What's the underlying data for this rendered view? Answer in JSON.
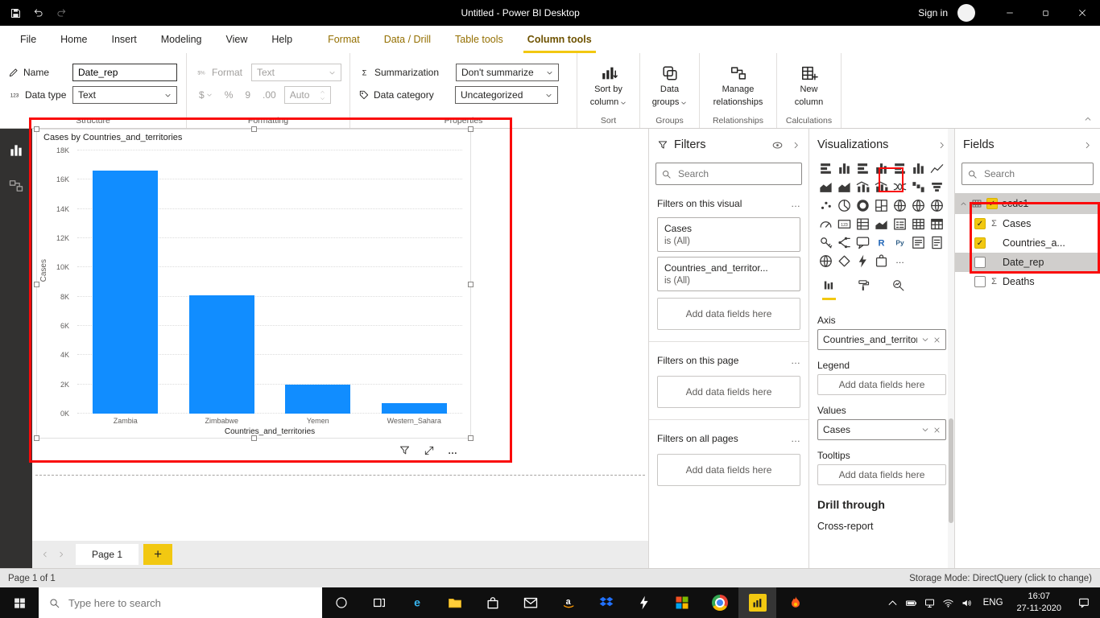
{
  "window": {
    "title": "Untitled - Power BI Desktop",
    "sign_in_label": "Sign in"
  },
  "ribbon": {
    "tabs": [
      {
        "label": "File",
        "kind": "normal"
      },
      {
        "label": "Home",
        "kind": "normal"
      },
      {
        "label": "Insert",
        "kind": "normal"
      },
      {
        "label": "Modeling",
        "kind": "normal"
      },
      {
        "label": "View",
        "kind": "normal"
      },
      {
        "label": "Help",
        "kind": "normal"
      },
      {
        "label": "Format",
        "kind": "contextual"
      },
      {
        "label": "Data / Drill",
        "kind": "contextual"
      },
      {
        "label": "Table tools",
        "kind": "contextual"
      },
      {
        "label": "Column tools",
        "kind": "contextual",
        "active": true
      }
    ],
    "structure": {
      "label": "Structure",
      "name_label": "Name",
      "name_value": "Date_rep",
      "datatype_label": "Data type",
      "datatype_value": "Text"
    },
    "formatting": {
      "label": "Formatting",
      "format_label": "Format",
      "format_value": "Text",
      "currency": "$",
      "percent": "%",
      "thousands": "9",
      "decimal": ".00",
      "auto_value": "Auto"
    },
    "properties": {
      "label": "Properties",
      "summarization_label": "Summarization",
      "summarization_value": "Don't summarize",
      "category_label": "Data category",
      "category_value": "Uncategorized"
    },
    "sort": {
      "label": "Sort",
      "line1": "Sort by",
      "line2": "column"
    },
    "data_groups": {
      "label": "Groups",
      "line1": "Data",
      "line2": "groups"
    },
    "relationships": {
      "label": "Relationships",
      "line1": "Manage",
      "line2": "relationships"
    },
    "calculations": {
      "label": "Calculations",
      "line1": "New",
      "line2": "column"
    }
  },
  "chart_data": {
    "type": "bar",
    "title": "Cases by Countries_and_territories",
    "categories": [
      "Zambia",
      "Zimbabwe",
      "Yemen",
      "Western_Sahara"
    ],
    "values": [
      16600,
      8100,
      2000,
      700
    ],
    "xlabel": "Countries_and_territories",
    "ylabel": "Cases",
    "ylim": [
      0,
      18000
    ],
    "yticks": [
      "0K",
      "2K",
      "4K",
      "6K",
      "8K",
      "10K",
      "12K",
      "14K",
      "16K",
      "18K"
    ],
    "bar_color": "#118DFF",
    "grid": true,
    "legend": false
  },
  "page": {
    "tab_label": "Page 1"
  },
  "statusbar": {
    "left": "Page 1 of 1",
    "right": "Storage Mode: DirectQuery (click to change)"
  },
  "filters": {
    "header": "Filters",
    "search_placeholder": "Search",
    "add_fields_label": "Add data fields here",
    "sections": [
      {
        "label": "Filters on this visual",
        "cards": [
          {
            "title": "Cases",
            "condition": "is (All)"
          },
          {
            "title": "Countries_and_territor...",
            "condition": "is (All)"
          }
        ],
        "show_empty_well": true
      },
      {
        "label": "Filters on this page",
        "cards": [],
        "show_empty_well": true
      },
      {
        "label": "Filters on all pages",
        "cards": [],
        "show_empty_well": true
      }
    ]
  },
  "visualizations": {
    "header": "Visualizations",
    "add_fields_label": "Add data fields here",
    "icons": [
      {
        "name": "stacked-bar-chart",
        "glyph": "barh"
      },
      {
        "name": "stacked-column-chart",
        "glyph": "colv"
      },
      {
        "name": "clustered-bar-chart",
        "glyph": "barh"
      },
      {
        "name": "clustered-column-chart",
        "glyph": "colv",
        "highlighted": true
      },
      {
        "name": "100-stacked-bar-chart",
        "glyph": "barh"
      },
      {
        "name": "100-stacked-column-chart",
        "glyph": "colv"
      },
      {
        "name": "line-chart",
        "glyph": "line"
      },
      {
        "name": "area-chart",
        "glyph": "area"
      },
      {
        "name": "stacked-area-chart",
        "glyph": "area"
      },
      {
        "name": "line-and-stacked-column-chart",
        "glyph": "combo"
      },
      {
        "name": "line-and-clustered-column-chart",
        "glyph": "combo"
      },
      {
        "name": "ribbon-chart",
        "glyph": "ribbonc"
      },
      {
        "name": "waterfall-chart",
        "glyph": "waterfall"
      },
      {
        "name": "funnel-chart",
        "glyph": "funnelc"
      },
      {
        "name": "scatter-chart",
        "glyph": "scatter"
      },
      {
        "name": "pie-chart",
        "glyph": "pie"
      },
      {
        "name": "donut-chart",
        "glyph": "donut"
      },
      {
        "name": "treemap",
        "glyph": "treemap"
      },
      {
        "name": "map",
        "glyph": "globe"
      },
      {
        "name": "filled-map",
        "glyph": "globe"
      },
      {
        "name": "shape-map",
        "glyph": "globe"
      },
      {
        "name": "gauge",
        "glyph": "gauge"
      },
      {
        "name": "card",
        "glyph": "card123"
      },
      {
        "name": "multi-row-card",
        "glyph": "mcard"
      },
      {
        "name": "kpi",
        "glyph": "kpi"
      },
      {
        "name": "slicer",
        "glyph": "slicer"
      },
      {
        "name": "table",
        "glyph": "tableic"
      },
      {
        "name": "matrix",
        "glyph": "matrix"
      },
      {
        "name": "key-influencers",
        "glyph": "keyinf"
      },
      {
        "name": "decomposition-tree",
        "glyph": "dtree"
      },
      {
        "name": "qa-visual",
        "glyph": "qa"
      },
      {
        "name": "r-script-visual",
        "glyph": "textR"
      },
      {
        "name": "python-visual",
        "glyph": "textPy"
      },
      {
        "name": "smart-narrative",
        "glyph": "narrative"
      },
      {
        "name": "paginated-report",
        "glyph": "pagreport"
      },
      {
        "name": "arcgis-map",
        "glyph": "globe"
      },
      {
        "name": "power-apps",
        "glyph": "papps"
      },
      {
        "name": "power-automate",
        "glyph": "zap"
      },
      {
        "name": "custom-visual",
        "glyph": "puzzle"
      },
      {
        "name": "get-more-visuals",
        "glyph": "dots"
      }
    ],
    "subtabs": [
      {
        "name": "fields",
        "active": true
      },
      {
        "name": "format",
        "active": false
      },
      {
        "name": "analytics",
        "active": false
      }
    ],
    "wells": [
      {
        "label": "Axis",
        "kind": "field",
        "value": "Countries_and_territorie"
      },
      {
        "label": "Legend",
        "kind": "empty"
      },
      {
        "label": "Values",
        "kind": "field",
        "value": "Cases"
      },
      {
        "label": "Tooltips",
        "kind": "empty"
      }
    ],
    "drill_through_label": "Drill through",
    "cross_report_label": "Cross-report"
  },
  "fields": {
    "header": "Fields",
    "search_placeholder": "Search",
    "table": {
      "name": "ecdc1"
    },
    "items": [
      {
        "label": "Cases",
        "sigma": true,
        "checked": true,
        "selected": false
      },
      {
        "label": "Countries_a...",
        "sigma": false,
        "checked": true,
        "selected": false
      },
      {
        "label": "Date_rep",
        "sigma": false,
        "checked": false,
        "selected": true
      },
      {
        "label": "Deaths",
        "sigma": true,
        "checked": false,
        "selected": false
      }
    ]
  },
  "taskbar": {
    "search_placeholder": "Type here to search",
    "buttons": [
      {
        "name": "cortana",
        "glyph": "cortana"
      },
      {
        "name": "task-view",
        "glyph": "taskview"
      }
    ],
    "apps": [
      {
        "name": "edge",
        "glyph": "edge"
      },
      {
        "name": "file-explorer",
        "glyph": "folder"
      },
      {
        "name": "microsoft-store",
        "glyph": "bag"
      },
      {
        "name": "mail",
        "glyph": "envelope"
      },
      {
        "name": "amazon",
        "glyph": "amazon"
      },
      {
        "name": "dropbox",
        "glyph": "dropbox"
      },
      {
        "name": "power-automate",
        "glyph": "zap"
      },
      {
        "name": "office",
        "glyph": "officegrid"
      },
      {
        "name": "chrome",
        "glyph": "chrome"
      },
      {
        "name": "power-bi",
        "glyph": "pbibars",
        "active": true
      },
      {
        "name": "flame-app",
        "glyph": "flame"
      }
    ],
    "tray": [
      {
        "name": "hidden-icons",
        "glyph": "chevU"
      },
      {
        "name": "battery",
        "glyph": "battery"
      },
      {
        "name": "network",
        "glyph": "ethernet"
      },
      {
        "name": "wifi",
        "glyph": "wifi"
      },
      {
        "name": "volume",
        "glyph": "volume"
      }
    ],
    "language": "ENG",
    "time": "16:07",
    "date": "27-11-2020"
  }
}
